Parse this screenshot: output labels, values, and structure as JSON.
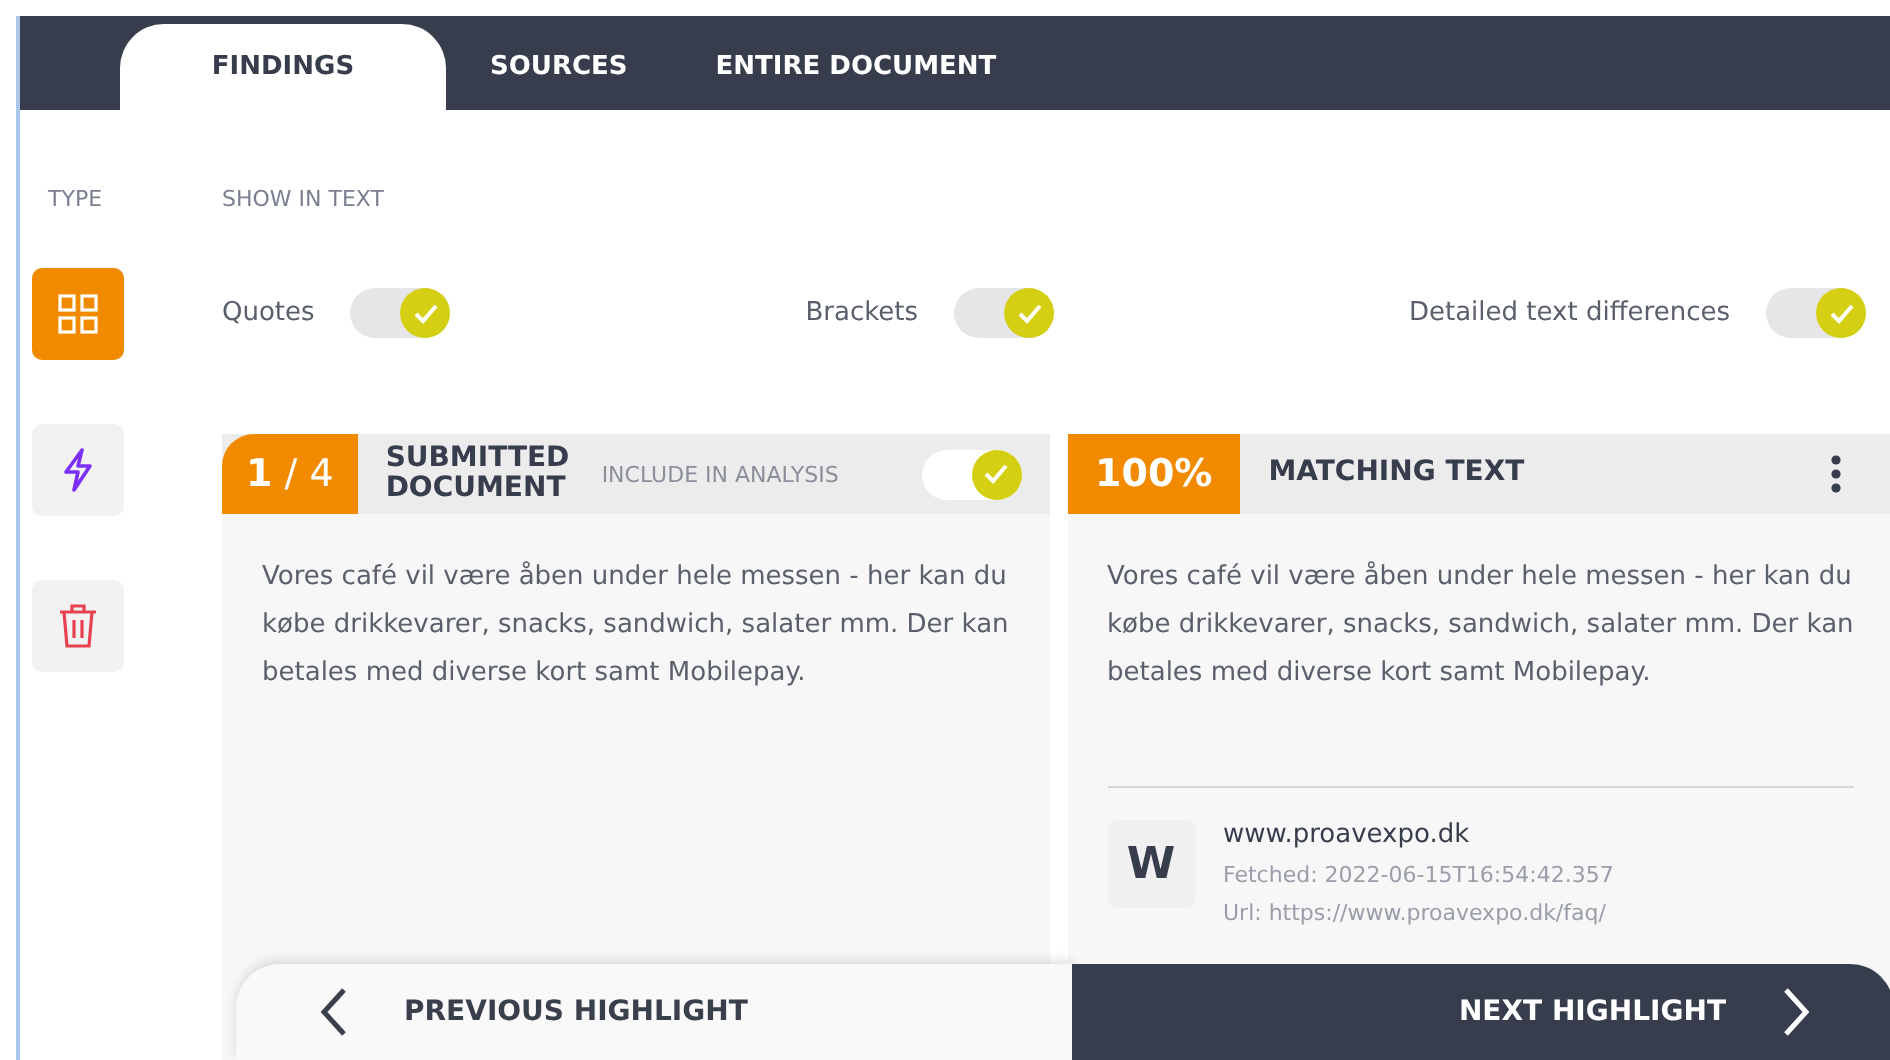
{
  "tabs": [
    {
      "label": "FINDINGS",
      "selected": true
    },
    {
      "label": "SOURCES",
      "selected": false
    },
    {
      "label": "ENTIRE DOCUMENT",
      "selected": false
    }
  ],
  "type_label": "TYPE",
  "show_in_text_label": "SHOW IN TEXT",
  "type_buttons": [
    {
      "kind": "grid",
      "selected": true
    },
    {
      "kind": "bolt",
      "selected": false
    },
    {
      "kind": "trash",
      "selected": false
    }
  ],
  "toggles": [
    {
      "label": "Quotes",
      "on": true
    },
    {
      "label": "Brackets",
      "on": true
    },
    {
      "label": "Detailed text differences",
      "on": true
    }
  ],
  "submitted": {
    "counter": "**1** / 4",
    "title": "SUBMITTED DOCUMENT",
    "include_label": "INCLUDE IN ANALYSIS",
    "include_on": true,
    "text": "Vores café vil være åben under hele messen - her kan du købe drikkevarer, snacks, sandwich, salater mm. Der kan betales med diverse kort samt Mobilepay."
  },
  "matching": {
    "percent": "100%",
    "title": "MATCHING TEXT",
    "text": "Vores café vil være åben under hele messen - her kan du købe drikkevarer, snacks, sandwich, salater mm. Der kan betales med diverse kort samt Mobilepay.",
    "source": {
      "letter": "W",
      "site": "www.proavexpo.dk",
      "fetched": "Fetched: 2022-06-15T16:54:42.357",
      "url": "Url: https://www.proavexpo.dk/faq/"
    }
  },
  "nav": {
    "previous": "PREVIOUS HIGHLIGHT",
    "next": "NEXT HIGHLIGHT"
  }
}
